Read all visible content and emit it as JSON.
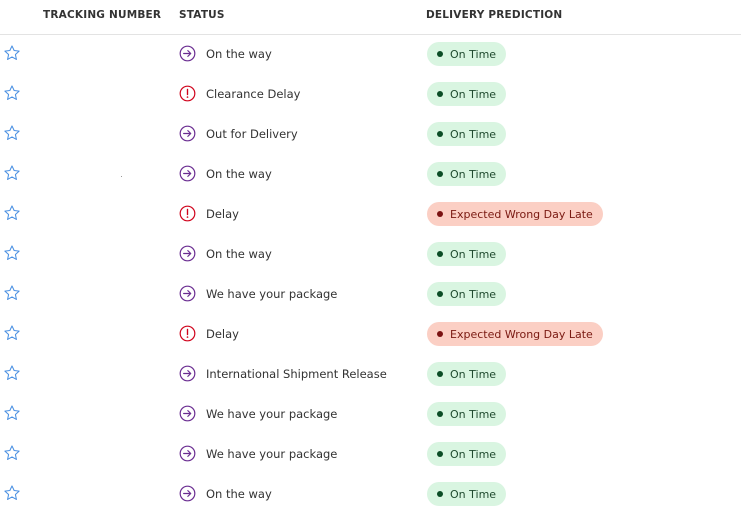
{
  "header": {
    "tracking_number": "TRACKING NUMBER",
    "status": "STATUS",
    "delivery_prediction": "DELIVERY PREDICTION"
  },
  "colors": {
    "star_outline": "#4a90e2",
    "status_ok_icon": "#6a2c91",
    "status_alert_icon": "#d0021b",
    "on_time_bg": "#d9f5e1",
    "late_bg": "#fbcfc4"
  },
  "rows": [
    {
      "status": "On the way",
      "status_icon": "arrow-circle-icon",
      "prediction": "On Time",
      "prediction_type": "ontime"
    },
    {
      "status": "Clearance Delay",
      "status_icon": "alert-circle-icon",
      "prediction": "On Time",
      "prediction_type": "ontime"
    },
    {
      "status": "Out for Delivery",
      "status_icon": "arrow-circle-icon",
      "prediction": "On Time",
      "prediction_type": "ontime"
    },
    {
      "status": "On the way",
      "status_icon": "arrow-circle-icon",
      "prediction": "On Time",
      "prediction_type": "ontime"
    },
    {
      "status": "Delay",
      "status_icon": "alert-circle-icon",
      "prediction": "Expected Wrong Day Late",
      "prediction_type": "late"
    },
    {
      "status": "On the way",
      "status_icon": "arrow-circle-icon",
      "prediction": "On Time",
      "prediction_type": "ontime"
    },
    {
      "status": "We have your package",
      "status_icon": "arrow-circle-icon",
      "prediction": "On Time",
      "prediction_type": "ontime"
    },
    {
      "status": "Delay",
      "status_icon": "alert-circle-icon",
      "prediction": "Expected Wrong Day Late",
      "prediction_type": "late"
    },
    {
      "status": "International Shipment Release",
      "status_icon": "arrow-circle-icon",
      "prediction": "On Time",
      "prediction_type": "ontime"
    },
    {
      "status": "We have your package",
      "status_icon": "arrow-circle-icon",
      "prediction": "On Time",
      "prediction_type": "ontime"
    },
    {
      "status": "We have your package",
      "status_icon": "arrow-circle-icon",
      "prediction": "On Time",
      "prediction_type": "ontime"
    },
    {
      "status": "On the way",
      "status_icon": "arrow-circle-icon",
      "prediction": "On Time",
      "prediction_type": "ontime"
    }
  ]
}
